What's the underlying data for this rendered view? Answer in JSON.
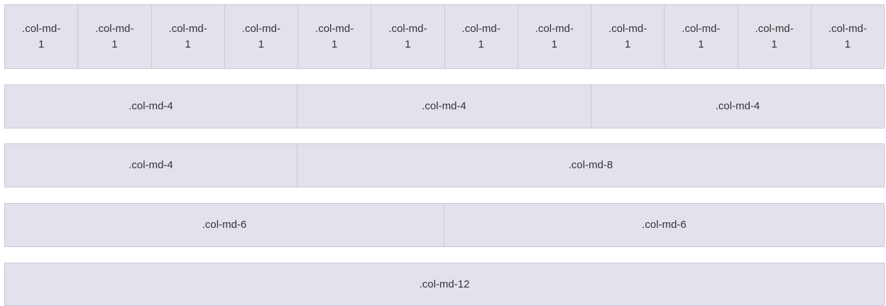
{
  "rows": [
    {
      "name": "row-twelve-col-md-1",
      "columns": [
        ".col-md-1",
        ".col-md-1",
        ".col-md-1",
        ".col-md-1",
        ".col-md-1",
        ".col-md-1",
        ".col-md-1",
        ".col-md-1",
        ".col-md-1",
        ".col-md-1",
        ".col-md-1",
        ".col-md-1"
      ]
    },
    {
      "name": "row-three-col-md-4",
      "columns": [
        ".col-md-4",
        ".col-md-4",
        ".col-md-4"
      ]
    },
    {
      "name": "row-col-md-4-col-md-8",
      "columns": [
        ".col-md-4",
        ".col-md-8"
      ]
    },
    {
      "name": "row-two-col-md-6",
      "columns": [
        ".col-md-6",
        ".col-md-6"
      ]
    },
    {
      "name": "row-col-md-12",
      "columns": [
        ".col-md-12"
      ]
    }
  ],
  "colors": {
    "cell_background": "#e4e1ec",
    "cell_border": "#cbc6da",
    "text": "#333333"
  }
}
